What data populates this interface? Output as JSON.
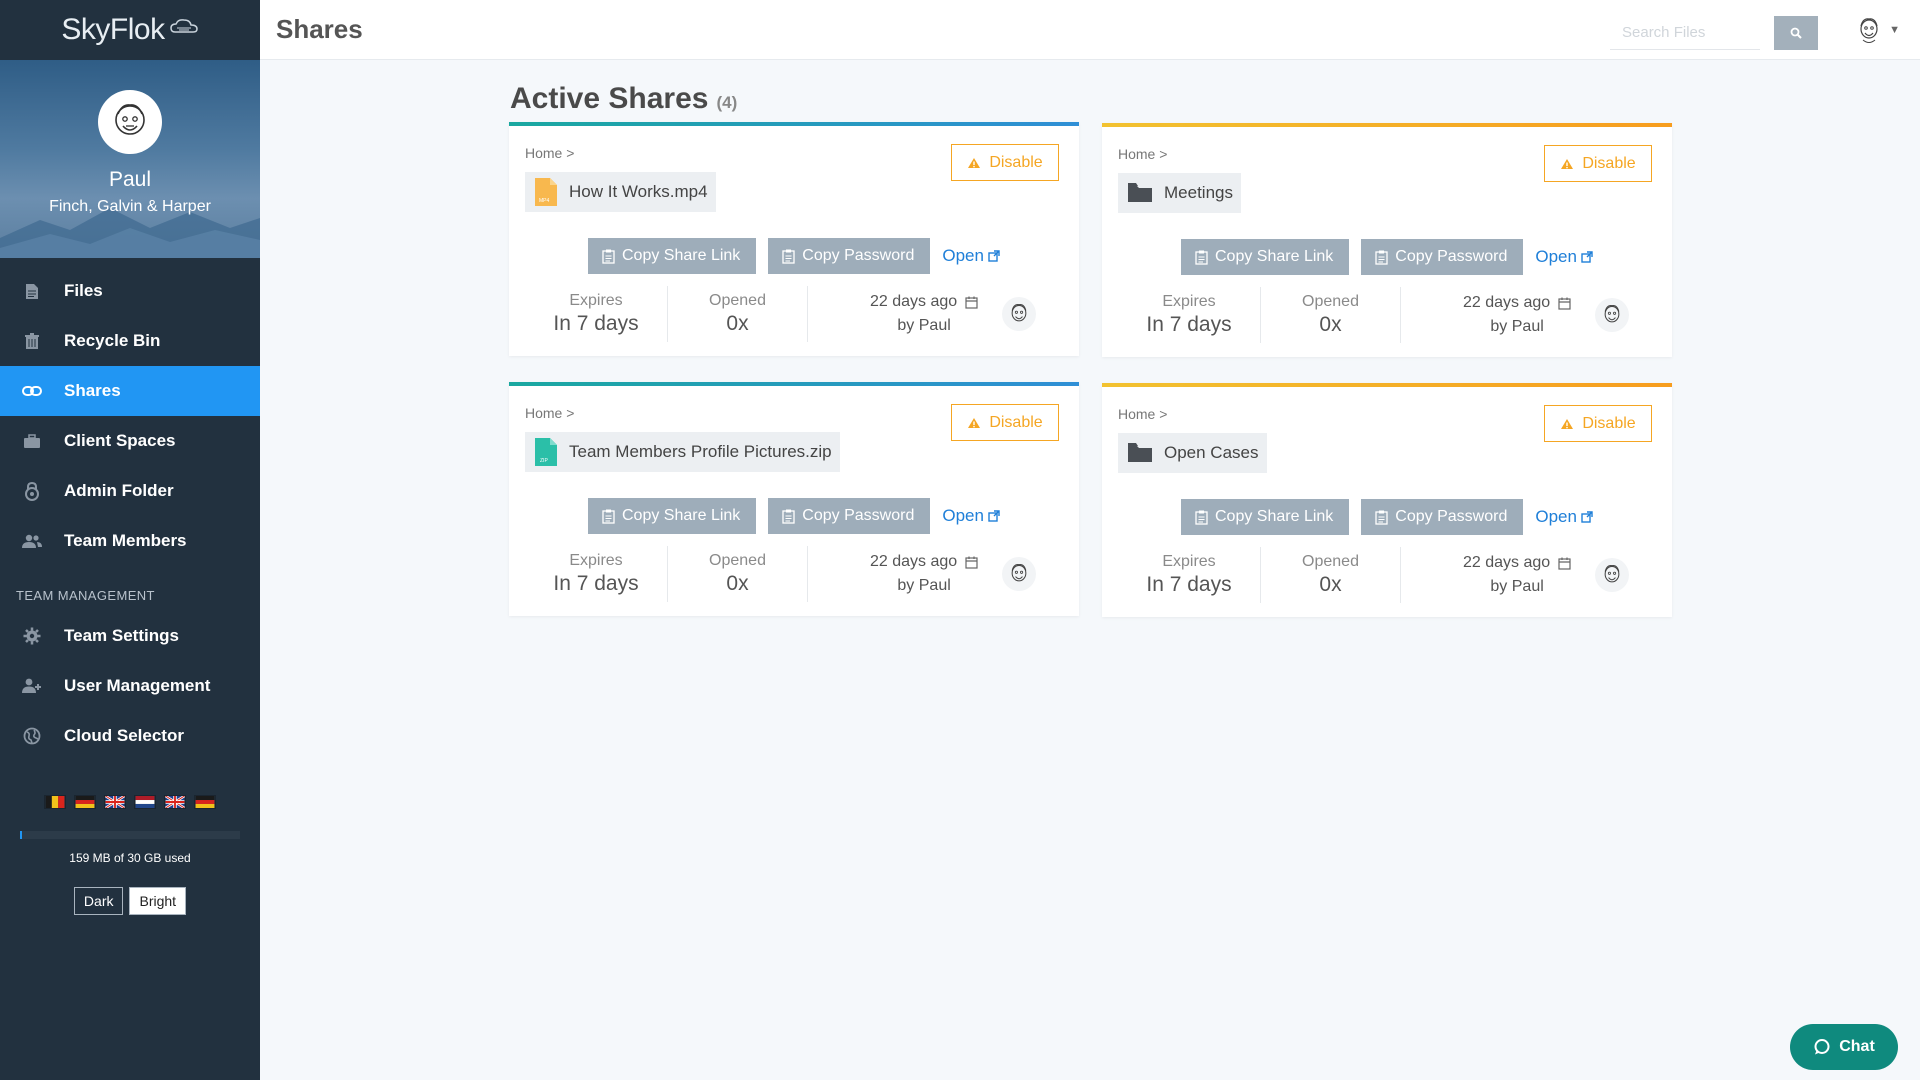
{
  "brand": {
    "name": "SkyFlok"
  },
  "profile": {
    "name": "Paul",
    "company": "Finch, Galvin & Harper"
  },
  "sidebar": {
    "items": [
      {
        "label": "Files",
        "icon": "file-icon"
      },
      {
        "label": "Recycle Bin",
        "icon": "trash-icon"
      },
      {
        "label": "Shares",
        "icon": "link-icon",
        "active": true
      },
      {
        "label": "Client Spaces",
        "icon": "briefcase-icon"
      },
      {
        "label": "Admin Folder",
        "icon": "lock-icon"
      },
      {
        "label": "Team Members",
        "icon": "users-icon"
      }
    ],
    "section_title": "TEAM MANAGEMENT",
    "management_items": [
      {
        "label": "Team Settings",
        "icon": "gear-icon"
      },
      {
        "label": "User Management",
        "icon": "user-plus-icon"
      },
      {
        "label": "Cloud Selector",
        "icon": "globe-icon"
      }
    ],
    "flags": [
      "belgium",
      "germany",
      "uk",
      "netherlands",
      "uk",
      "germany"
    ],
    "storage": {
      "text": "159 MB of 30 GB used",
      "fraction": 0.005
    },
    "theme": {
      "dark_label": "Dark",
      "bright_label": "Bright",
      "selected": "Bright"
    }
  },
  "topbar": {
    "title": "Shares",
    "search_placeholder": "Search Files"
  },
  "main": {
    "heading": "Active Shares",
    "count": "(4)",
    "shares": [
      {
        "breadcrumb": "Home >",
        "name": "How It Works.mp4",
        "type": "video",
        "accent": "teal",
        "disable_label": "Disable",
        "copy_link_label": "Copy Share Link",
        "copy_password_label": "Copy Password",
        "open_label": "Open",
        "expires_label": "Expires",
        "expires_value": "In 7 days",
        "opened_label": "Opened",
        "opened_value": "0x",
        "created": "22 days ago",
        "by": "by Paul"
      },
      {
        "breadcrumb": "Home >",
        "name": "Meetings",
        "type": "folder",
        "accent": "orange",
        "disable_label": "Disable",
        "copy_link_label": "Copy Share Link",
        "copy_password_label": "Copy Password",
        "open_label": "Open",
        "expires_label": "Expires",
        "expires_value": "In 7 days",
        "opened_label": "Opened",
        "opened_value": "0x",
        "created": "22 days ago",
        "by": "by Paul"
      },
      {
        "breadcrumb": "Home >",
        "name": "Team Members Profile Pictures.zip",
        "type": "zip",
        "accent": "teal",
        "disable_label": "Disable",
        "copy_link_label": "Copy Share Link",
        "copy_password_label": "Copy Password",
        "open_label": "Open",
        "expires_label": "Expires",
        "expires_value": "In 7 days",
        "opened_label": "Opened",
        "opened_value": "0x",
        "created": "22 days ago",
        "by": "by Paul"
      },
      {
        "breadcrumb": "Home >",
        "name": "Open Cases",
        "type": "folder",
        "accent": "orange",
        "disable_label": "Disable",
        "copy_link_label": "Copy Share Link",
        "copy_password_label": "Copy Password",
        "open_label": "Open",
        "expires_label": "Expires",
        "expires_value": "In 7 days",
        "opened_label": "Opened",
        "opened_value": "0x",
        "created": "22 days ago",
        "by": "by Paul"
      }
    ]
  },
  "chat": {
    "label": "Chat"
  },
  "colors": {
    "sidebar": "#22313f",
    "active": "#2196f3",
    "teal": "#1aa8a0",
    "orange": "#f5a623",
    "button": "#9eadba",
    "link": "#1f7fd8",
    "chat": "#0f8a7e"
  }
}
